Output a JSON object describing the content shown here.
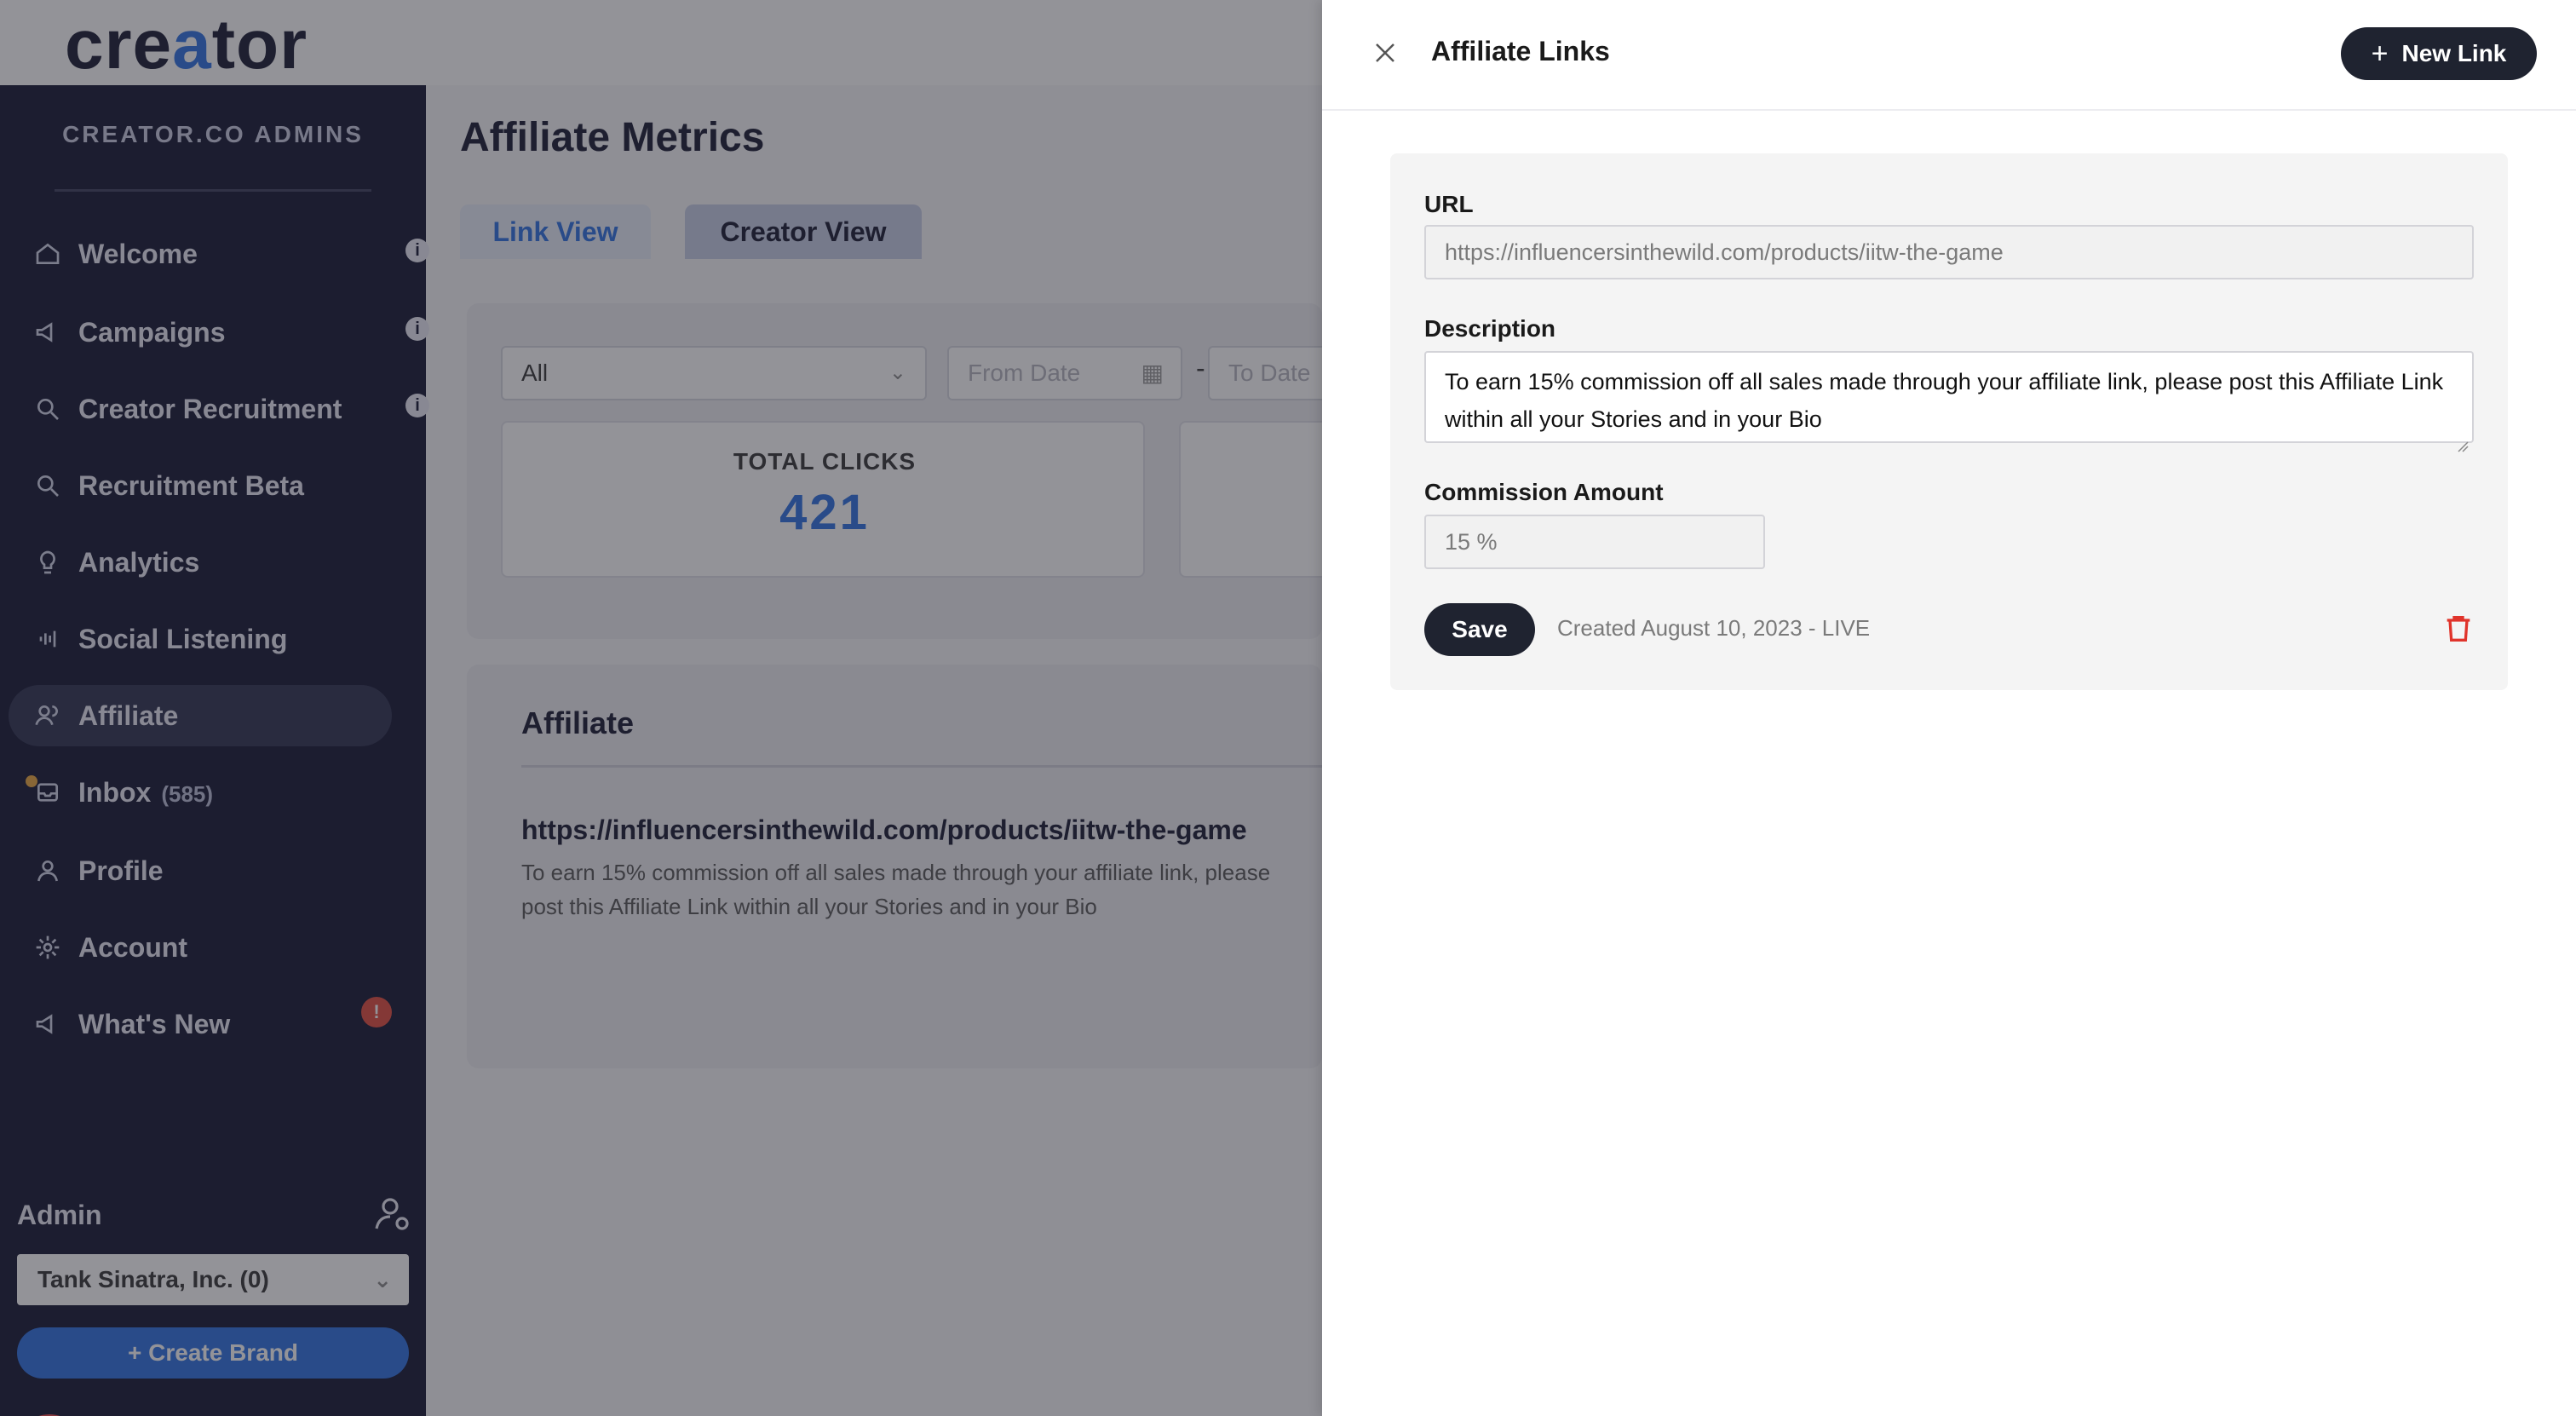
{
  "background": {
    "logo": {
      "pre": "cre",
      "accent": "a",
      "post": "tor"
    },
    "sidebar": {
      "title": "CREATOR.CO ADMINS",
      "items": [
        {
          "label": "Welcome",
          "icon": "home-icon"
        },
        {
          "label": "Campaigns",
          "icon": "megaphone-icon"
        },
        {
          "label": "Creator Recruitment",
          "icon": "search-icon"
        },
        {
          "label": "Recruitment Beta",
          "icon": "search-icon"
        },
        {
          "label": "Analytics",
          "icon": "lightbulb-icon"
        },
        {
          "label": "Social Listening",
          "icon": "sound-waves-icon"
        },
        {
          "label": "Affiliate",
          "icon": "users-icon"
        },
        {
          "label": "Inbox",
          "count": "(585)",
          "icon": "inbox-icon"
        },
        {
          "label": "Profile",
          "icon": "user-icon"
        },
        {
          "label": "Account",
          "icon": "gear-icon"
        },
        {
          "label": "What's New",
          "icon": "megaphone-icon"
        }
      ],
      "info_glyph": "i",
      "alert_glyph": "!",
      "admin_label": "Admin",
      "brand_select": "Tank Sinatra, Inc. (0)",
      "create_brand": "+ Create Brand"
    },
    "main": {
      "title": "Affiliate Metrics",
      "tabs": [
        "Link View",
        "Creator View"
      ],
      "filter": {
        "selected": "All",
        "from_placeholder": "From Date",
        "dash": "-",
        "to_placeholder": "To Date"
      },
      "total_clicks_label": "TOTAL CLICKS",
      "total_clicks_value": "421",
      "affiliate_heading": "Affiliate",
      "affiliate_url": "https://influencersinthewild.com/products/iitw-the-game",
      "affiliate_desc": "To earn 15% commission off all sales made through your affiliate link, please post this Affiliate Link within all your Stories and in your Bio"
    }
  },
  "drawer": {
    "title": "Affiliate Links",
    "new_link_label": "New Link",
    "url_label": "URL",
    "url_value": "https://influencersinthewild.com/products/iitw-the-game",
    "description_label": "Description",
    "description_value": "To earn 15% commission off all sales made through your affiliate link, please post this Affiliate Link within all your Stories and in your Bio",
    "commission_label": "Commission Amount",
    "commission_value": "15 %",
    "save_label": "Save",
    "created_text": "Created August 10, 2023 - LIVE"
  },
  "colors": {
    "accent_blue": "#2a6fe0",
    "sidebar_bg": "#10122e",
    "button_dark": "#1f2330",
    "delete_red": "#e0342b"
  }
}
